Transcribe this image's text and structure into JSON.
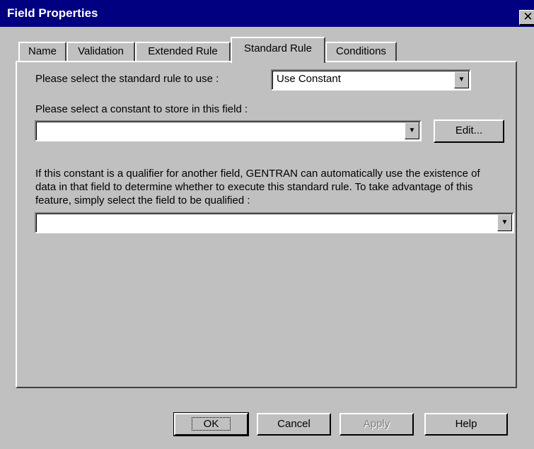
{
  "window": {
    "title": "Field Properties",
    "close_glyph": "✕"
  },
  "tabs": [
    {
      "label": "Name",
      "active": false
    },
    {
      "label": "Validation",
      "active": false
    },
    {
      "label": "Extended Rule",
      "active": false
    },
    {
      "label": "Standard Rule",
      "active": true
    },
    {
      "label": "Conditions",
      "active": false
    }
  ],
  "standard_rule": {
    "rule_prompt": "Please select the standard rule to use :",
    "rule_value": "Use Constant",
    "constant_prompt": "Please select a constant to store in this field :",
    "constant_value": "",
    "edit_label": "Edit...",
    "qualifier_text": "If this constant is a qualifier for another field, GENTRAN can automatically use the existence of data in that field to determine whether to execute this standard rule. To take advantage of this feature, simply select the field to be qualified :",
    "qualified_field_value": ""
  },
  "buttons": {
    "ok": "OK",
    "cancel": "Cancel",
    "apply": "Apply",
    "help": "Help"
  },
  "icons": {
    "dropdown": "chevron-down-icon",
    "close": "close-icon"
  },
  "colors": {
    "titlebar": "#000080",
    "face": "#c0c0c0"
  }
}
